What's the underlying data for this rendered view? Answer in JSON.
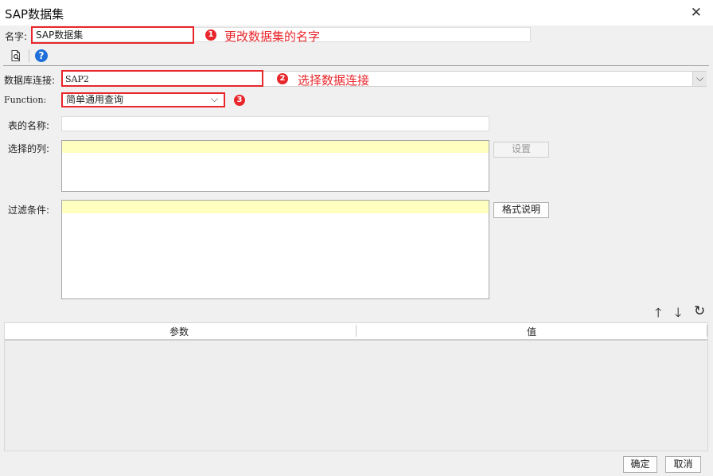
{
  "window": {
    "title": "SAP数据集",
    "close_glyph": "✕"
  },
  "name_field": {
    "label": "名字:",
    "value": "SAP数据集"
  },
  "annotations": [
    {
      "number": "1",
      "text": "更改数据集的名字"
    },
    {
      "number": "2",
      "text": "选择数据连接"
    },
    {
      "number": "3"
    }
  ],
  "toolbar": {
    "preview_icon": "preview-icon",
    "help_icon": "help-icon",
    "help_glyph": "?"
  },
  "db_connection": {
    "label": "数据库连接:",
    "value": "SAP2",
    "chevron": "⌵"
  },
  "function": {
    "label": "Function:",
    "value": "简单通用查询",
    "chevron": "⌵"
  },
  "table_name": {
    "label": "表的名称:",
    "value": ""
  },
  "selected_columns": {
    "label": "选择的列:",
    "button_label": "设置"
  },
  "filter": {
    "label": "过滤条件:",
    "button_label": "格式说明"
  },
  "param_tools": {
    "up": "🡑",
    "down": "🡓",
    "refresh": "↻"
  },
  "params_table": {
    "columns": [
      "参数",
      "值"
    ],
    "rows": []
  },
  "footer": {
    "ok_label": "确定",
    "cancel_label": "取消"
  },
  "colors": {
    "annotation_red": "#e8262b",
    "highlight_yellow": "#ffffc0",
    "help_blue": "#1e6fd9"
  }
}
